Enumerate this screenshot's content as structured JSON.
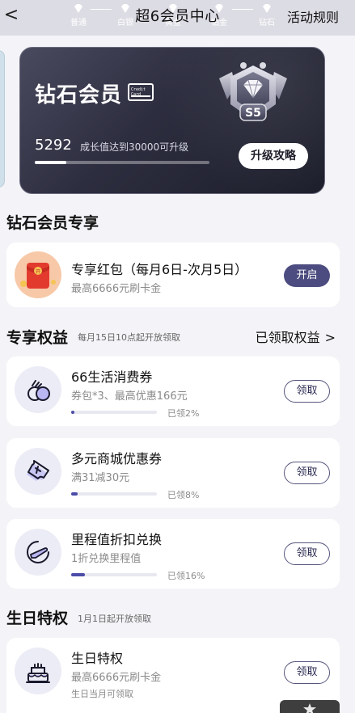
{
  "header": {
    "back_glyph": "<",
    "title": "超6会员中心",
    "rules_link": "活动规则",
    "tiers": [
      "普通",
      "白银",
      "黄金",
      "铂金",
      "钻石"
    ]
  },
  "member_card": {
    "level_name": "钻石会员",
    "card_icon_text": "Credit Card",
    "growth_value": "5292",
    "growth_note": "成长值达到30000可升级",
    "growth_progress": 0.18,
    "upgrade_button": "升级攻略",
    "badge_text": "S5"
  },
  "exclusive": {
    "title": "钻石会员专享",
    "red_packet": {
      "title": "专享红包（每月6日-次月5日）",
      "subtitle": "最高6666元刷卡金",
      "button": "开启"
    }
  },
  "benefits": {
    "title": "专享权益",
    "subtitle": "每月15日10点起开放领取",
    "link": "已领取权益",
    "link_chevron": ">",
    "items": [
      {
        "title": "66生活消费券",
        "subtitle": "券包*3、最高优惠166元",
        "claimed": "已领2%",
        "progress": 0.02,
        "button": "领取",
        "icon": "coupon-circles-icon"
      },
      {
        "title": "多元商城优惠券",
        "subtitle": "满31减30元",
        "claimed": "已领8%",
        "progress": 0.08,
        "button": "领取",
        "icon": "ticket-icon"
      },
      {
        "title": "里程值折扣兑换",
        "subtitle": "1折兑换里程值",
        "claimed": "已领16%",
        "progress": 0.16,
        "button": "领取",
        "icon": "plane-icon"
      }
    ]
  },
  "birthday": {
    "title": "生日特权",
    "subtitle": "1月1日起开放领取",
    "item": {
      "title": "生日特权",
      "subtitle": "最高6666元刷卡金",
      "note": "生日当月可领取",
      "button": "领取",
      "icon": "cake-icon"
    }
  },
  "colors": {
    "accent": "#4c4c80",
    "card_dark": "#2c2d3e",
    "progress": "#4b4ca8"
  }
}
